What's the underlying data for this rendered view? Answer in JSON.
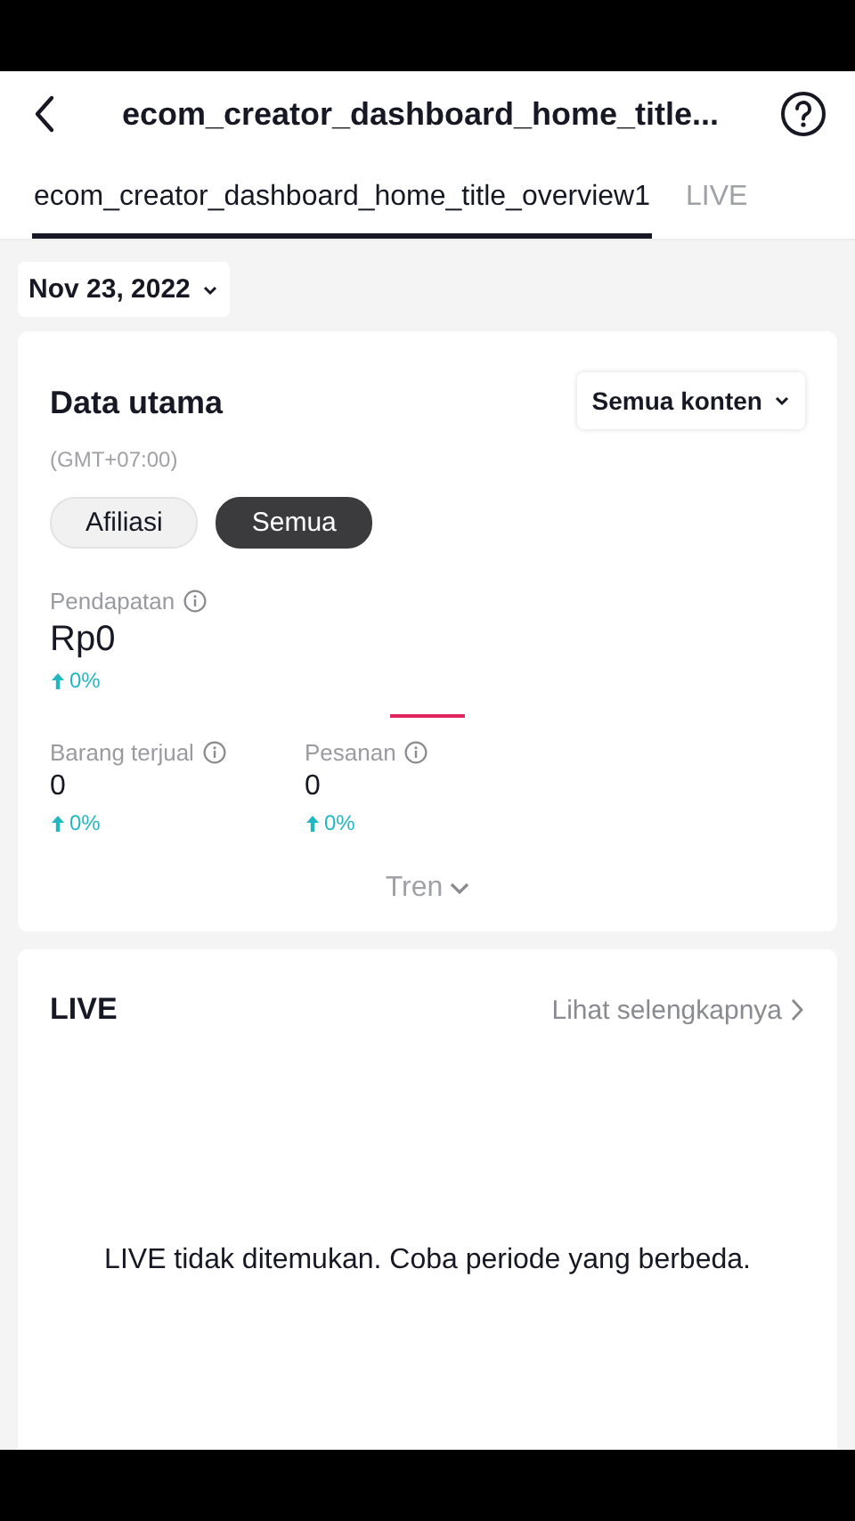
{
  "header": {
    "title": "ecom_creator_dashboard_home_title..."
  },
  "tabs": [
    {
      "label": "ecom_creator_dashboard_home_title_overview1",
      "selected": true
    },
    {
      "label": "LIVE",
      "selected": false
    }
  ],
  "date_picker": {
    "value": "Nov 23, 2022"
  },
  "main_data": {
    "title": "Data utama",
    "timezone": "(GMT+07:00)",
    "content_filter": "Semua konten",
    "filters": [
      {
        "label": "Afiliasi",
        "selected": false
      },
      {
        "label": "Semua",
        "selected": true
      }
    ],
    "primary_metric": {
      "label": "Pendapatan",
      "value": "Rp0",
      "change": "0%"
    },
    "metrics": [
      {
        "label": "Barang terjual",
        "value": "0",
        "change": "0%"
      },
      {
        "label": "Pesanan",
        "value": "0",
        "change": "0%"
      }
    ],
    "trend_toggle": "Tren"
  },
  "live": {
    "title": "LIVE",
    "see_more": "Lihat selengkapnya",
    "empty_message": "LIVE tidak ditemukan. Coba periode yang berbeda."
  }
}
